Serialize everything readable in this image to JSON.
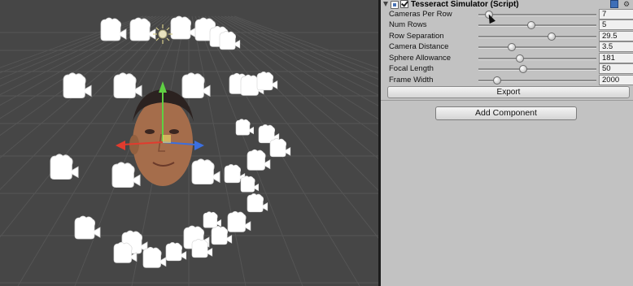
{
  "component": {
    "title": "Tesseract Simulator (Script)",
    "enabled": true
  },
  "properties": [
    {
      "label": "Cameras Per Row",
      "value": "7",
      "fraction": 0.09
    },
    {
      "label": "Num Rows",
      "value": "5",
      "fraction": 0.45
    },
    {
      "label": "Row Separation",
      "value": "29.5",
      "fraction": 0.62
    },
    {
      "label": "Camera Distance",
      "value": "3.5",
      "fraction": 0.28
    },
    {
      "label": "Sphere Allowance",
      "value": "181",
      "fraction": 0.35
    },
    {
      "label": "Focal Length",
      "value": "50",
      "fraction": 0.38
    },
    {
      "label": "Frame Width",
      "value": "2000",
      "fraction": 0.16
    }
  ],
  "buttons": {
    "export": "Export",
    "add_component": "Add Component"
  },
  "colors": {
    "scene_bg": "#454545",
    "grid": "#5a5a5a",
    "inspector_bg": "#c2c2c2",
    "gizmo_x": "#e23b2e",
    "gizmo_y": "#5fd043",
    "gizmo_z": "#3b6fe0"
  }
}
